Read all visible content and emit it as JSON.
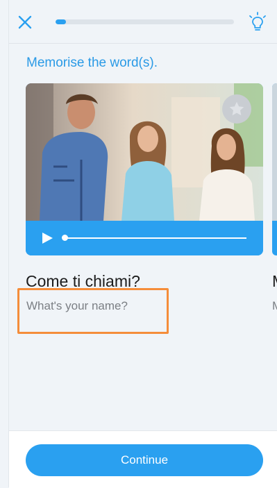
{
  "header": {
    "close_icon": "close-icon",
    "hint_icon": "lightbulb-icon",
    "progress": 0.06
  },
  "instruction": "Memorise the word(s).",
  "card": {
    "image": "photo of three friends talking",
    "favorite_icon": "star-icon",
    "play_icon": "play-icon",
    "playback_position": 0.0
  },
  "phrase": "Come ti chiami?",
  "translation": "What's your name?",
  "next_card": {
    "phrase_peek": "M",
    "translation_peek": "M"
  },
  "footer": {
    "continue_label": "Continue"
  },
  "colors": {
    "accent": "#2aa0f0",
    "highlight_box": "#f58d3a",
    "background": "#f0f4f8"
  }
}
